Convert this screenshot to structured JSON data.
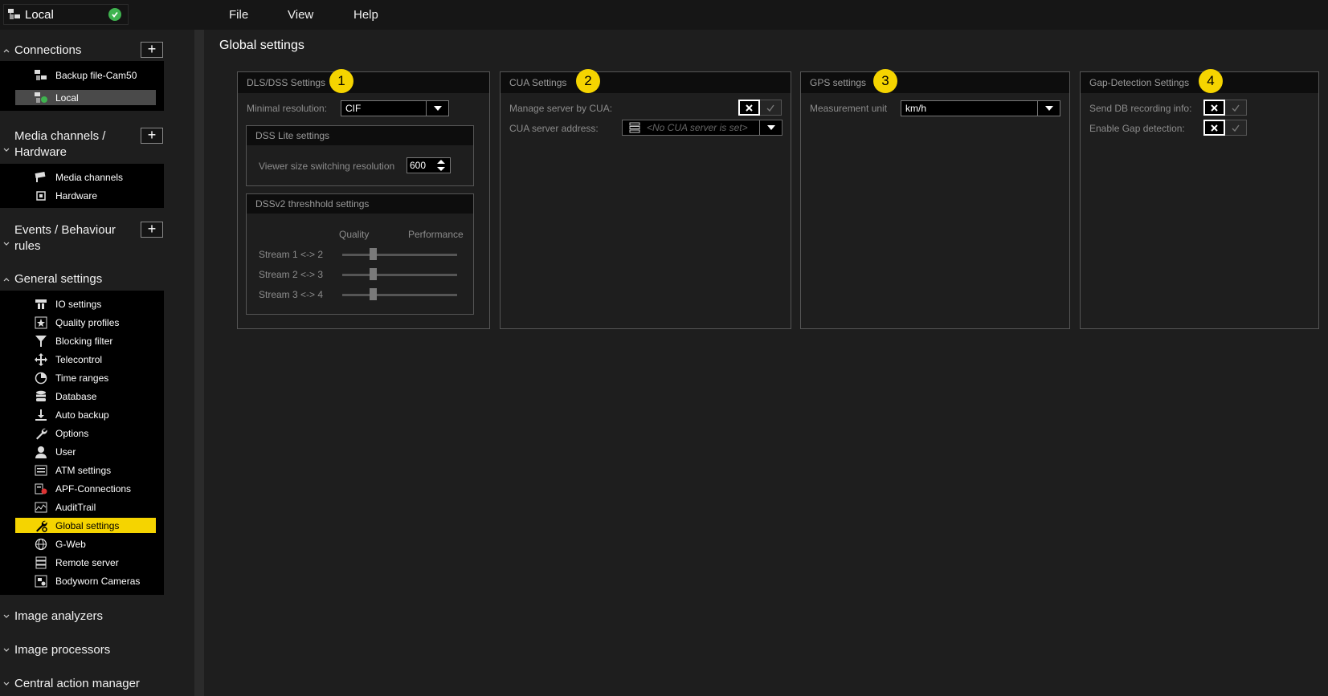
{
  "connection": {
    "name": "Local",
    "status": "connected"
  },
  "menu": {
    "file": "File",
    "view": "View",
    "help": "Help"
  },
  "sidebar": {
    "connections": {
      "label": "Connections",
      "items": [
        {
          "label": "Backup file-Cam50",
          "icon": "network-server-icon"
        },
        {
          "label": "Local",
          "icon": "network-server-ok-icon"
        }
      ]
    },
    "media": {
      "label1": "Media channels /",
      "label2": "Hardware",
      "items": [
        {
          "label": "Media channels",
          "icon": "camera-icon"
        },
        {
          "label": "Hardware",
          "icon": "chip-icon"
        }
      ]
    },
    "events": {
      "label1": "Events / Behaviour",
      "label2": "rules"
    },
    "general": {
      "label": "General settings",
      "items": [
        {
          "label": "IO settings",
          "icon": "io-icon"
        },
        {
          "label": "Quality profiles",
          "icon": "star-icon"
        },
        {
          "label": "Blocking filter",
          "icon": "filter-icon"
        },
        {
          "label": "Telecontrol",
          "icon": "move-arrows-icon"
        },
        {
          "label": "Time ranges",
          "icon": "pie-clock-icon"
        },
        {
          "label": "Database",
          "icon": "database-icon"
        },
        {
          "label": "Auto backup",
          "icon": "download-icon"
        },
        {
          "label": "Options",
          "icon": "wrench-icon"
        },
        {
          "label": "User",
          "icon": "user-icon"
        },
        {
          "label": "ATM settings",
          "icon": "atm-icon"
        },
        {
          "label": "APF-Connections",
          "icon": "apf-icon"
        },
        {
          "label": "AuditTrail",
          "icon": "audit-chart-icon"
        },
        {
          "label": "Global settings",
          "icon": "global-wrench-icon"
        },
        {
          "label": "G-Web",
          "icon": "globe-icon"
        },
        {
          "label": "Remote server",
          "icon": "server-icon"
        },
        {
          "label": "Bodyworn Cameras",
          "icon": "bodycam-icon"
        }
      ]
    },
    "image_analyzers": "Image analyzers",
    "image_processors": "Image processors",
    "central_action": "Central action manager"
  },
  "main": {
    "title": "Global settings",
    "dls": {
      "title": "DLS/DSS Settings",
      "badge": "1",
      "min_res_label": "Minimal resolution:",
      "min_res_value": "CIF",
      "lite": {
        "title": "DSS Lite settings",
        "viewer_label": "Viewer size switching resolution",
        "viewer_value": "600"
      },
      "v2": {
        "title": "DSSv2 threshhold settings",
        "quality": "Quality",
        "performance": "Performance",
        "streams": [
          {
            "label": "Stream 1 <-> 2",
            "level": 0.25
          },
          {
            "label": "Stream 2 <-> 3",
            "level": 0.25
          },
          {
            "label": "Stream 3 <-> 4",
            "level": 0.25
          }
        ]
      }
    },
    "cua": {
      "title": "CUA Settings",
      "badge": "2",
      "manage_label": "Manage server by CUA:",
      "address_label": "CUA server address:",
      "address_placeholder": "<No CUA server is set>"
    },
    "gps": {
      "title": "GPS settings",
      "badge": "3",
      "unit_label": "Measurement unit",
      "unit_value": "km/h"
    },
    "gap": {
      "title": "Gap-Detection Settings",
      "badge": "4",
      "send_label": "Send DB recording info:",
      "enable_label": "Enable Gap detection:"
    }
  },
  "colors": {
    "accent": "#f5d400",
    "background": "#1e1e1e",
    "panel_head": "#0d0d0d",
    "status_ok": "#3fb34f"
  }
}
